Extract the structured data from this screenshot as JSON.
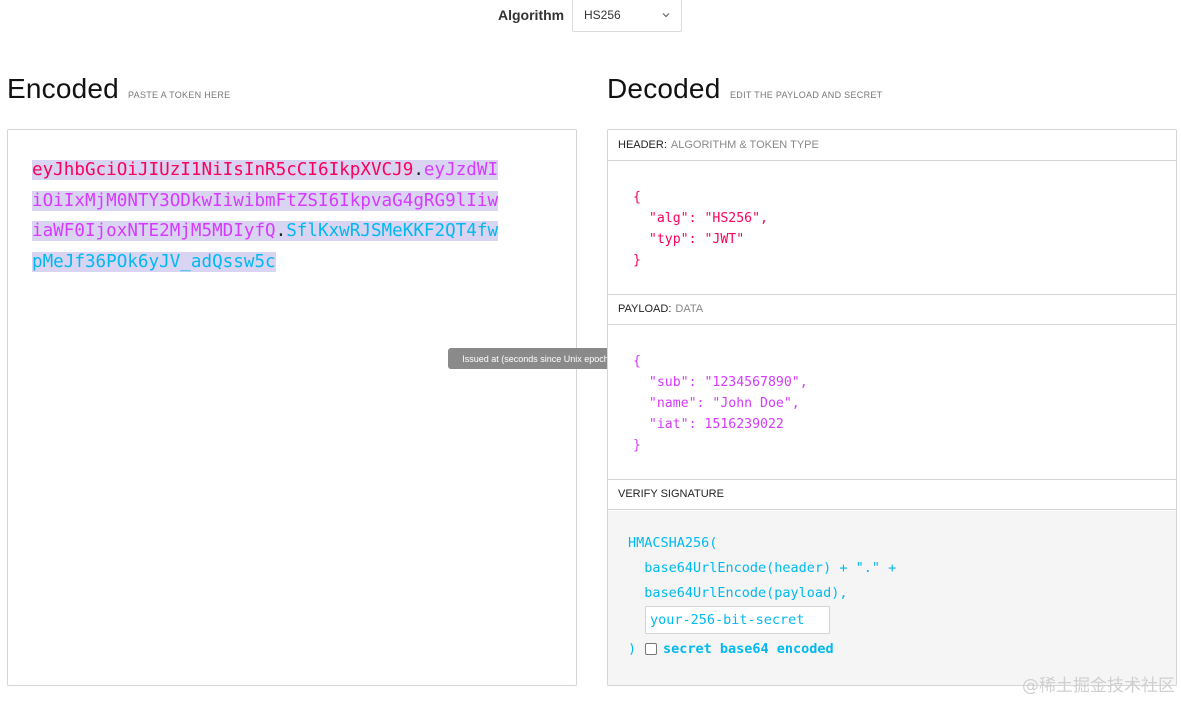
{
  "algorithm": {
    "label": "Algorithm",
    "selected": "HS256"
  },
  "encoded": {
    "title": "Encoded",
    "subtitle": "PASTE A TOKEN HERE",
    "token": {
      "header": "eyJhbGciOiJIUzI1NiIsInR5cCI6IkpXVCJ9",
      "payload": "eyJzdWIiOiIxMjM0NTY3ODkwIiwibmFtZSI6IkpvaG4gRG9lIiwiaWF0IjoxNTE2MjM5MDIyfQ",
      "signature": "SflKxwRJSMeKKF2QT4fwpMeJf36POk6yJV_adQssw5c",
      "dot": "."
    },
    "tooltip": "Issued at (seconds since Unix epoch)"
  },
  "decoded": {
    "title": "Decoded",
    "subtitle": "EDIT THE PAYLOAD AND SECRET",
    "header": {
      "label": "HEADER:",
      "sub": "ALGORITHM & TOKEN TYPE",
      "json": "{\n  \"alg\": \"HS256\",\n  \"typ\": \"JWT\"\n}"
    },
    "payload": {
      "label": "PAYLOAD:",
      "sub": "DATA",
      "json": "{\n  \"sub\": \"1234567890\",\n  \"name\": \"John Doe\",\n  \"iat\": 1516239022\n}"
    },
    "verify": {
      "label": "VERIFY SIGNATURE",
      "line1": "HMACSHA256(",
      "line2": "  base64UrlEncode(header) + \".\" +",
      "line3": "  base64UrlEncode(payload),",
      "secret_value": "your-256-bit-secret",
      "close": ")",
      "checkbox_label": "secret base64 encoded"
    }
  },
  "watermark": "@稀土掘金技术社区"
}
